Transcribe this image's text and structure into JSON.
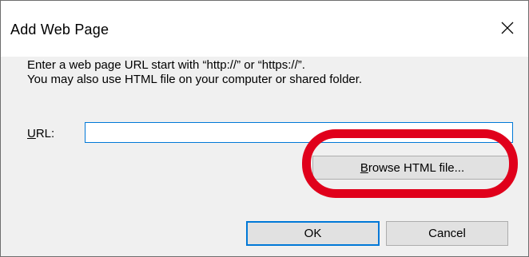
{
  "dialog": {
    "title": "Add Web Page",
    "close_icon": "close-icon",
    "instructions_line1": "Enter a web page URL start with “http://” or “https://”.",
    "instructions_line2": "You may also use HTML file on your computer or shared folder.",
    "url_label_access_key": "U",
    "url_label_rest": "RL:",
    "url_value": "",
    "browse_button_access_key": "B",
    "browse_button_rest": "rowse HTML file...",
    "ok_label": "OK",
    "cancel_label": "Cancel"
  },
  "colors": {
    "accent": "#0078d7",
    "highlight": "#e0001b",
    "dialog_bg": "#f0f0f0",
    "button_bg": "#e1e1e1"
  }
}
